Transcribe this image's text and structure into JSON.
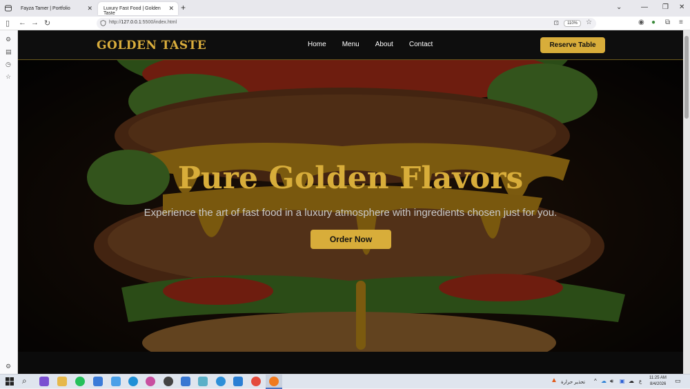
{
  "browser": {
    "tabs": [
      {
        "title": "Fayza Tamer | Portfolio",
        "active": false
      },
      {
        "title": "Luxury Fast Food | Golden Taste",
        "active": true
      }
    ],
    "url_prefix": "http://",
    "url_host": "127.0.0.1",
    "url_rest": ":5500/index.html",
    "zoom": "110%"
  },
  "site": {
    "logo": "GOLDEN TASTE",
    "nav": [
      "Home",
      "Menu",
      "About",
      "Contact"
    ],
    "reserve_label": "Reserve Table",
    "accent_color": "#d8ad3a"
  },
  "hero": {
    "title": "Pure Golden Flavors",
    "subtitle": "Experience the art of fast food in a luxury atmosphere with ingredients chosen just for you.",
    "cta_label": "Order Now"
  },
  "taskbar": {
    "weather_text": "تحذير حرارة",
    "time": "11:25 AM",
    "date": "8/4/2026",
    "lang": "ع"
  }
}
